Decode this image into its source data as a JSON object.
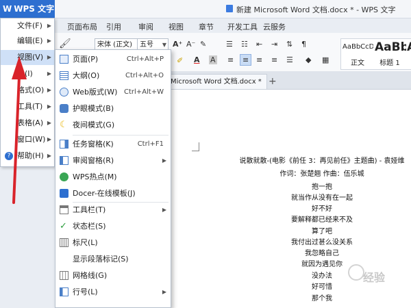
{
  "app": {
    "menu_button": "WPS 文字",
    "window_title": "新建 Microsoft Word 文档.docx * - WPS 文字"
  },
  "ribbon": {
    "tabs": [
      "页面布局",
      "引用",
      "审阅",
      "视图",
      "章节",
      "开发工具",
      "云服务"
    ],
    "font_name": "宋体 (正文)",
    "font_size": "五号",
    "styles": [
      {
        "preview": "AaBbCcDd",
        "name": "正文"
      },
      {
        "preview": "AaBb",
        "name": "标题 1"
      },
      {
        "preview": "Aa"
      }
    ]
  },
  "document_tab": {
    "title": "Microsoft Word 文档.docx *",
    "new_tab": "+"
  },
  "main_menu": {
    "items": [
      {
        "label": "文件(F)"
      },
      {
        "label": "编辑(E)"
      },
      {
        "label": "视图(V)"
      },
      {
        "label": "入(I)"
      },
      {
        "label": "格式(O)"
      },
      {
        "label": "工具(T)"
      },
      {
        "label": "表格(A)"
      },
      {
        "label": "窗口(W)"
      },
      {
        "label": "帮助(H)"
      }
    ]
  },
  "view_submenu": {
    "items": [
      {
        "label": "页面(P)",
        "shortcut": "Ctrl+Alt+P"
      },
      {
        "label": "大纲(O)",
        "shortcut": "Ctrl+Alt+O"
      },
      {
        "label": "Web版式(W)",
        "shortcut": "Ctrl+Alt+W"
      },
      {
        "label": "护眼模式(B)",
        "shortcut": ""
      },
      {
        "label": "夜间模式(G)",
        "shortcut": ""
      },
      {
        "label": "任务窗格(K)",
        "shortcut": "Ctrl+F1"
      },
      {
        "label": "审阅窗格(R)",
        "shortcut": ""
      },
      {
        "label": "WPS热点(M)",
        "shortcut": ""
      },
      {
        "label": "Docer-在线模板(J)",
        "shortcut": ""
      },
      {
        "label": "工具栏(T)",
        "shortcut": ""
      },
      {
        "label": "状态栏(S)",
        "shortcut": ""
      },
      {
        "label": "标尺(L)",
        "shortcut": ""
      },
      {
        "label": "显示段落标记(S)",
        "shortcut": ""
      },
      {
        "label": "网格线(G)",
        "shortcut": ""
      },
      {
        "label": "行号(L)",
        "shortcut": ""
      }
    ]
  },
  "document": {
    "lines": [
      "说散就散-(电影《前任 3：再见前任》主题曲) - 袁娅维",
      "作词：张楚翘 作曲：伍乐城",
      "抱一抱",
      "就当作从没有在一起",
      "好不好",
      "要解释都已经来不及",
      "算了吧",
      "我付出过甚么没关系",
      "我忽略自己",
      "就因为遇见你",
      "没办法",
      "好可惜",
      "那个我"
    ]
  },
  "watermark": "经验",
  "colors": {
    "accent": "#2d6fd0",
    "highlight": "#cfe0f7",
    "arrow": "#d9232a"
  }
}
